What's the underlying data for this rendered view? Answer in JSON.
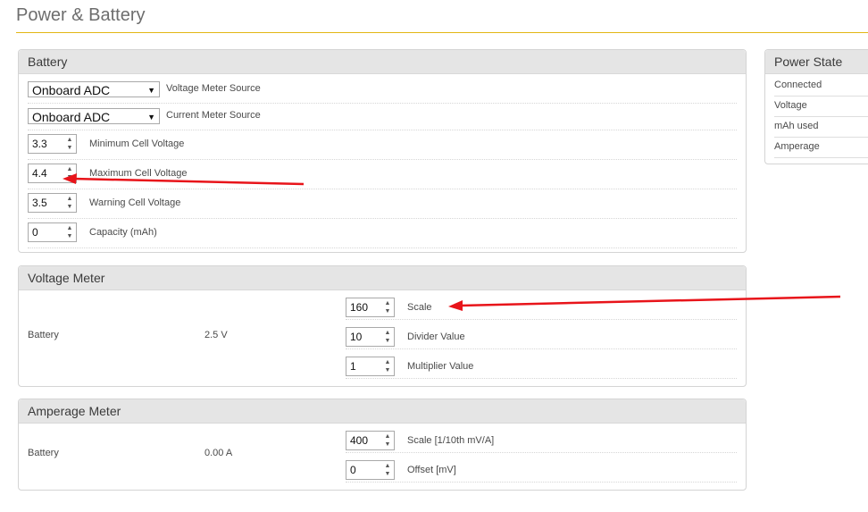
{
  "page": {
    "title": "Power & Battery"
  },
  "battery": {
    "title": "Battery",
    "voltage_source": {
      "value": "Onboard ADC",
      "label": "Voltage Meter Source"
    },
    "current_source": {
      "value": "Onboard ADC",
      "label": "Current Meter Source"
    },
    "min_cell": {
      "value": "3.3",
      "label": "Minimum Cell Voltage"
    },
    "max_cell": {
      "value": "4.4",
      "label": "Maximum Cell Voltage"
    },
    "warn_cell": {
      "value": "3.5",
      "label": "Warning Cell Voltage"
    },
    "capacity": {
      "value": "0",
      "label": "Capacity (mAh)"
    }
  },
  "voltage_meter": {
    "title": "Voltage Meter",
    "name": "Battery",
    "reading": "2.5 V",
    "scale": {
      "value": "160",
      "label": "Scale"
    },
    "divider": {
      "value": "10",
      "label": "Divider Value"
    },
    "multiplier": {
      "value": "1",
      "label": "Multiplier Value"
    }
  },
  "amperage_meter": {
    "title": "Amperage Meter",
    "name": "Battery",
    "reading": "0.00 A",
    "scale": {
      "value": "400",
      "label": "Scale [1/10th mV/A]"
    },
    "offset": {
      "value": "0",
      "label": "Offset [mV]"
    }
  },
  "power_state": {
    "title": "Power State",
    "rows": [
      "Connected",
      "Voltage",
      "mAh used",
      "Amperage"
    ]
  },
  "annotation_color": "#e8141a"
}
